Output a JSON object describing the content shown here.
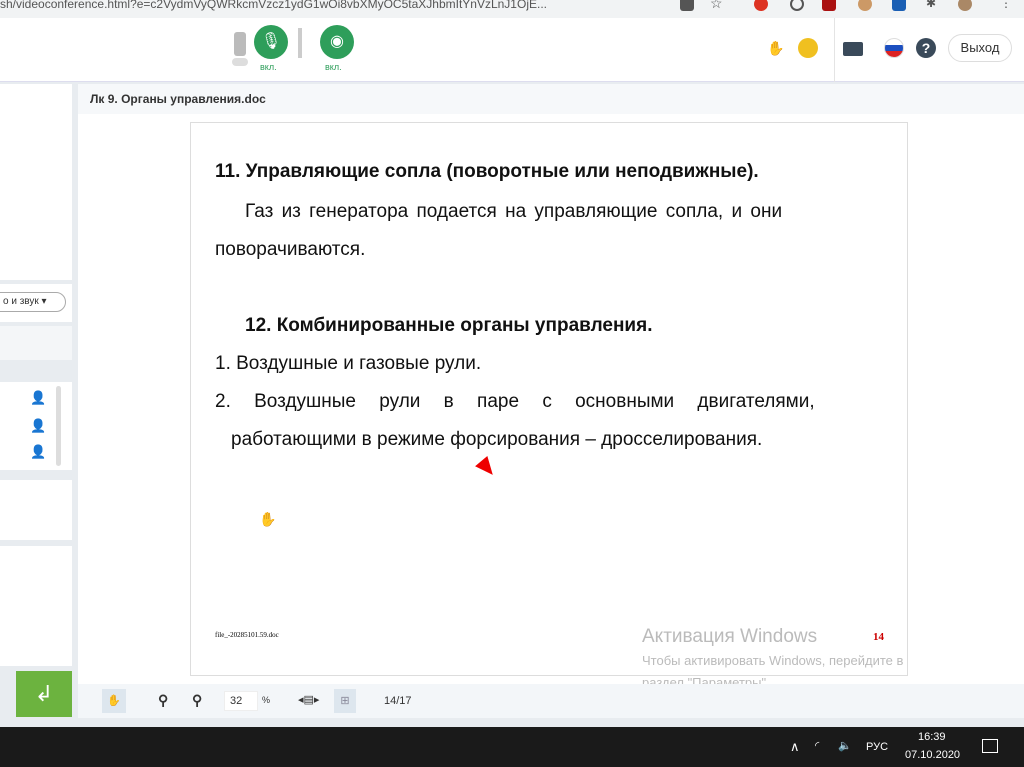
{
  "browser": {
    "url": "sh/videoconference.html?e=c2VydmVyQWRkcmVzcz1ydG1wOi8vbXMyOC5taXJhbmItYnVzLnJ1OjE..."
  },
  "header": {
    "mic_label": "вкл.",
    "cam_label": "вкл.",
    "exit_label": "Выход"
  },
  "left_panel": {
    "dropdown": "о и звук"
  },
  "document": {
    "title": "Лк 9. Органы управления.doc",
    "heading1": "11. Управляющие сопла (поворотные или неподвижные).",
    "para1_line1": "Газ из генератора подается на управляющие сопла, и они",
    "para1_line2": "поворачиваются.",
    "heading2": "12. Комбинированные органы управления.",
    "item1": "1.  Воздушные и газовые рули.",
    "item2_line1": "2. Воздушные рули в паре с основными двигателями,",
    "item2_line2": "работающими в режиме форсирования – дросселирования.",
    "footer_file": "file_-20285101.59.doc",
    "page_number": "14"
  },
  "toolbar": {
    "zoom": "32",
    "zoom_unit": "%",
    "pages": "14/17"
  },
  "watermark": {
    "title": "Активация Windows",
    "line1": "Чтобы активировать Windows, перейдите в",
    "line2": "раздел \"Параметры\"."
  },
  "taskbar": {
    "lang": "РУС",
    "time": "16:39",
    "date": "07.10.2020"
  }
}
